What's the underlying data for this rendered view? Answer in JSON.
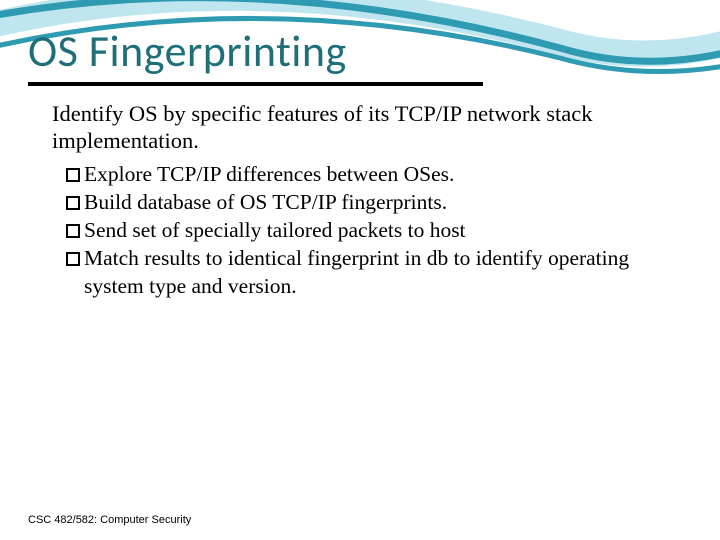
{
  "slide": {
    "title": "OS Fingerprinting",
    "intro": "Identify OS by specific features of its TCP/IP network stack implementation.",
    "bullets": [
      "Explore TCP/IP differences between OSes.",
      "Build database of OS TCP/IP fingerprints.",
      "Send set of specially tailored packets to host",
      "Match results to identical fingerprint in db to identify operating system type and version."
    ],
    "footer": "CSC 482/582: Computer Security"
  },
  "theme": {
    "title_color": "#1f6f79",
    "swoosh_primary": "#2f9bb3",
    "swoosh_light": "#bfe6ee"
  }
}
